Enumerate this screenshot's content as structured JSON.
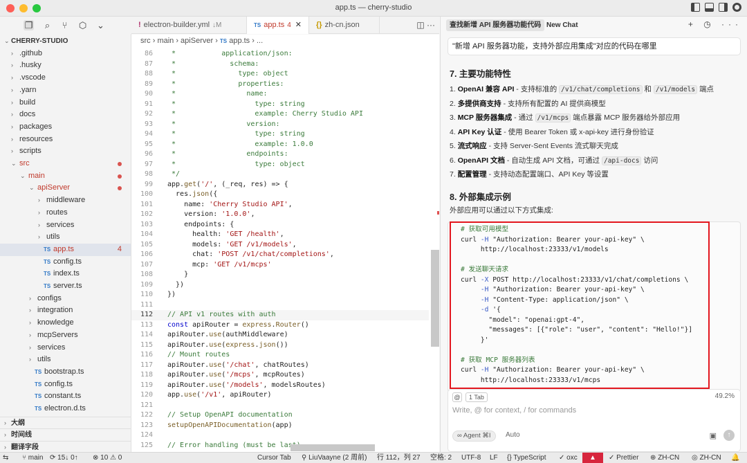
{
  "window": {
    "title": "app.ts — cherry-studio"
  },
  "explorer": {
    "root": "CHERRY-STUDIO",
    "items": [
      {
        "label": ".github",
        "depth": 0,
        "type": "folder"
      },
      {
        "label": ".husky",
        "depth": 0,
        "type": "folder"
      },
      {
        "label": ".vscode",
        "depth": 0,
        "type": "folder"
      },
      {
        "label": ".yarn",
        "depth": 0,
        "type": "folder"
      },
      {
        "label": "build",
        "depth": 0,
        "type": "folder"
      },
      {
        "label": "docs",
        "depth": 0,
        "type": "folder"
      },
      {
        "label": "packages",
        "depth": 0,
        "type": "folder"
      },
      {
        "label": "resources",
        "depth": 0,
        "type": "folder"
      },
      {
        "label": "scripts",
        "depth": 0,
        "type": "folder"
      },
      {
        "label": "src",
        "depth": 0,
        "type": "folder-open",
        "modified": true
      },
      {
        "label": "main",
        "depth": 1,
        "type": "folder-open",
        "modified": true
      },
      {
        "label": "apiServer",
        "depth": 2,
        "type": "folder-open",
        "modified": true
      },
      {
        "label": "middleware",
        "depth": 3,
        "type": "folder"
      },
      {
        "label": "routes",
        "depth": 3,
        "type": "folder"
      },
      {
        "label": "services",
        "depth": 3,
        "type": "folder"
      },
      {
        "label": "utils",
        "depth": 3,
        "type": "folder"
      },
      {
        "label": "app.ts",
        "depth": 3,
        "type": "ts",
        "selected": true,
        "count": "4"
      },
      {
        "label": "config.ts",
        "depth": 3,
        "type": "ts"
      },
      {
        "label": "index.ts",
        "depth": 3,
        "type": "ts"
      },
      {
        "label": "server.ts",
        "depth": 3,
        "type": "ts"
      },
      {
        "label": "configs",
        "depth": 2,
        "type": "folder"
      },
      {
        "label": "integration",
        "depth": 2,
        "type": "folder"
      },
      {
        "label": "knowledge",
        "depth": 2,
        "type": "folder"
      },
      {
        "label": "mcpServers",
        "depth": 2,
        "type": "folder"
      },
      {
        "label": "services",
        "depth": 2,
        "type": "folder"
      },
      {
        "label": "utils",
        "depth": 2,
        "type": "folder"
      },
      {
        "label": "bootstrap.ts",
        "depth": 2,
        "type": "ts"
      },
      {
        "label": "config.ts",
        "depth": 2,
        "type": "ts"
      },
      {
        "label": "constant.ts",
        "depth": 2,
        "type": "ts"
      },
      {
        "label": "electron.d.ts",
        "depth": 2,
        "type": "ts"
      }
    ],
    "sections": [
      "大纲",
      "时间线",
      "翻译字段"
    ]
  },
  "tabs": [
    {
      "prefix": "!",
      "label": "electron-builder.yml",
      "mod": "↓M"
    },
    {
      "prefix": "TS",
      "label": "app.ts",
      "mod": "4",
      "close": "✕",
      "active": true
    },
    {
      "prefix": "{}",
      "label": "zh-cn.json",
      "mod": ""
    }
  ],
  "breadcrumb": {
    "path": "src › main › apiServer › ",
    "ts": "TS",
    "file": "app.ts › ..."
  },
  "editor": {
    "current_line": 112,
    "lines": [
      {
        "n": 86,
        "t": " *           application/json:",
        "k": "cm"
      },
      {
        "n": 87,
        "t": " *             schema:",
        "k": "cm"
      },
      {
        "n": 88,
        "t": " *               type: object",
        "k": "cm"
      },
      {
        "n": 89,
        "t": " *               properties:",
        "k": "cm"
      },
      {
        "n": 90,
        "t": " *                 name:",
        "k": "cm"
      },
      {
        "n": 91,
        "t": " *                   type: string",
        "k": "cm"
      },
      {
        "n": 92,
        "t": " *                   example: Cherry Studio API",
        "k": "cm"
      },
      {
        "n": 93,
        "t": " *                 version:",
        "k": "cm"
      },
      {
        "n": 94,
        "t": " *                   type: string",
        "k": "cm"
      },
      {
        "n": 95,
        "t": " *                   example: 1.0.0",
        "k": "cm"
      },
      {
        "n": 96,
        "t": " *                 endpoints:",
        "k": "cm"
      },
      {
        "n": 97,
        "t": " *                   type: object",
        "k": "cm"
      },
      {
        "n": 98,
        "t": " */",
        "k": "cm"
      },
      {
        "n": 99,
        "t": "app.get('/', (_req, res) => {",
        "k": "code"
      },
      {
        "n": 100,
        "t": "  res.json({",
        "k": "code"
      },
      {
        "n": 101,
        "t": "    name: 'Cherry Studio API',",
        "k": "str"
      },
      {
        "n": 102,
        "t": "    version: '1.0.0',",
        "k": "str"
      },
      {
        "n": 103,
        "t": "    endpoints: {",
        "k": "code"
      },
      {
        "n": 104,
        "t": "      health: 'GET /health',",
        "k": "str"
      },
      {
        "n": 105,
        "t": "      models: 'GET /v1/models',",
        "k": "str"
      },
      {
        "n": 106,
        "t": "      chat: 'POST /v1/chat/completions',",
        "k": "str"
      },
      {
        "n": 107,
        "t": "      mcp: 'GET /v1/mcps'",
        "k": "str"
      },
      {
        "n": 108,
        "t": "    }",
        "k": "code"
      },
      {
        "n": 109,
        "t": "  })",
        "k": "code"
      },
      {
        "n": 110,
        "t": "})",
        "k": "code"
      },
      {
        "n": 111,
        "t": "",
        "k": "code"
      },
      {
        "n": 112,
        "t": "// API v1 routes with auth",
        "k": "cm"
      },
      {
        "n": 113,
        "t": "const apiRouter = express.Router()",
        "k": "code"
      },
      {
        "n": 114,
        "t": "apiRouter.use(authMiddleware)",
        "k": "code"
      },
      {
        "n": 115,
        "t": "apiRouter.use(express.json())",
        "k": "code"
      },
      {
        "n": 116,
        "t": "// Mount routes",
        "k": "cm"
      },
      {
        "n": 117,
        "t": "apiRouter.use('/chat', chatRoutes)",
        "k": "code"
      },
      {
        "n": 118,
        "t": "apiRouter.use('/mcps', mcpRoutes)",
        "k": "code"
      },
      {
        "n": 119,
        "t": "apiRouter.use('/models', modelsRoutes)",
        "k": "code"
      },
      {
        "n": 120,
        "t": "app.use('/v1', apiRouter)",
        "k": "code"
      },
      {
        "n": 121,
        "t": "",
        "k": "code"
      },
      {
        "n": 122,
        "t": "// Setup OpenAPI documentation",
        "k": "cm"
      },
      {
        "n": 123,
        "t": "setupOpenAPIDocumentation(app)",
        "k": "code"
      },
      {
        "n": 124,
        "t": "",
        "k": "code"
      },
      {
        "n": 125,
        "t": "// Error handling (must be last)",
        "k": "cm"
      }
    ]
  },
  "chat": {
    "tabs": [
      "查找新增 API 服务器功能代码",
      "New Chat"
    ],
    "actions": "+ ◷ ···",
    "user_message": "\"新增 API 服务器功能，支持外部应用集成\"对应的代码在哪里",
    "section7_title": "7. 主要功能特性",
    "features": [
      {
        "num": "1.",
        "bold": "OpenAI 兼容 API",
        "rest": " - 支持标准的 ",
        "code1": "/v1/chat/completions",
        "mid": " 和 ",
        "code2": "/v1/models",
        "end": " 端点"
      },
      {
        "num": "2.",
        "bold": "多提供商支持",
        "rest": " - 支持所有配置的 AI 提供商模型",
        "code1": "",
        "mid": "",
        "code2": "",
        "end": ""
      },
      {
        "num": "3.",
        "bold": "MCP 服务器集成",
        "rest": " - 通过 ",
        "code1": "/v1/mcps",
        "mid": " 端点暴露 MCP 服务器给外部应用",
        "code2": "",
        "end": ""
      },
      {
        "num": "4.",
        "bold": "API Key 认证",
        "rest": " - 使用 Bearer Token 或 x-api-key 进行身份验证",
        "code1": "",
        "mid": "",
        "code2": "",
        "end": ""
      },
      {
        "num": "5.",
        "bold": "流式响应",
        "rest": " - 支持 Server-Sent Events 流式聊天完成",
        "code1": "",
        "mid": "",
        "code2": "",
        "end": ""
      },
      {
        "num": "6.",
        "bold": "OpenAPI 文档",
        "rest": " - 自动生成 API 文档，可通过 ",
        "code1": "/api-docs",
        "mid": " 访问",
        "code2": "",
        "end": ""
      },
      {
        "num": "7.",
        "bold": "配置管理",
        "rest": " - 支持动态配置端口、API Key 等设置",
        "code1": "",
        "mid": "",
        "code2": "",
        "end": ""
      }
    ],
    "section8_title": "8. 外部集成示例",
    "section8_text": "外部应用可以通过以下方式集成:",
    "code_lines": [
      {
        "c": "cm",
        "t": "# 获取可用模型"
      },
      {
        "c": "cmd",
        "t": "curl -H \"Authorization: Bearer your-api-key\" \\"
      },
      {
        "c": "plain",
        "t": "     http://localhost:23333/v1/models"
      },
      {
        "c": "plain",
        "t": ""
      },
      {
        "c": "cm",
        "t": "# 发送聊天请求"
      },
      {
        "c": "cmd",
        "t": "curl -X POST http://localhost:23333/v1/chat/completions \\"
      },
      {
        "c": "plain",
        "t": "     -H \"Authorization: Bearer your-api-key\" \\"
      },
      {
        "c": "plain",
        "t": "     -H \"Content-Type: application/json\" \\"
      },
      {
        "c": "plain",
        "t": "     -d '{"
      },
      {
        "c": "plain",
        "t": "       \"model\": \"openai:gpt-4\","
      },
      {
        "c": "plain",
        "t": "       \"messages\": [{\"role\": \"user\", \"content\": \"Hello!\"}]"
      },
      {
        "c": "plain",
        "t": "     }'"
      },
      {
        "c": "plain",
        "t": ""
      },
      {
        "c": "cm",
        "t": "# 获取 MCP 服务器列表"
      },
      {
        "c": "cmd",
        "t": "curl -H \"Authorization: Bearer your-api-key\" \\"
      },
      {
        "c": "plain",
        "t": "     http://localhost:23333/v1/mcps"
      }
    ],
    "composer": {
      "at": "@",
      "tab": "1 Tab",
      "pct": "49.2%",
      "placeholder": "Write, @ for context, / for commands",
      "agent": "∞ Agent ⌘I",
      "auto": "Auto",
      "img": "▣",
      "send": "↑"
    }
  },
  "statusbar": {
    "branch": "main",
    "sync": "15↓ 0↑",
    "problems": "⊗ 10 ⚠ 0",
    "cursor_tab": "Cursor Tab",
    "blame": "LiuVaayne (2 周前)",
    "position": "行 112，列 27",
    "spaces": "空格: 2",
    "encoding": "UTF-8",
    "eol": "LF",
    "language": "TypeScript",
    "oxc": "oxc",
    "prettier": "Prettier",
    "lang1": "ZH-CN",
    "lang2": "ZH-CN",
    "bell": "🔔"
  }
}
